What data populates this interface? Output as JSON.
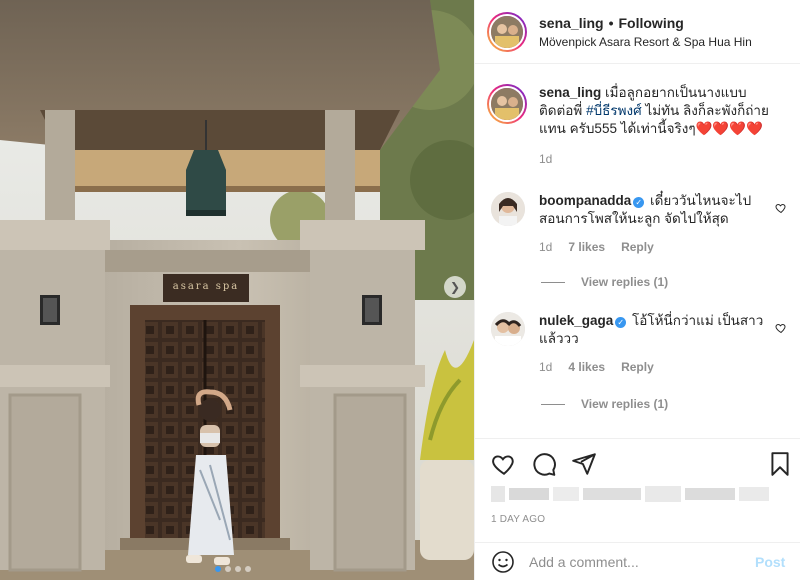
{
  "post": {
    "username": "sena_ling",
    "separator": "•",
    "follow_status": "Following",
    "location": "Mövenpick Asara Resort & Spa Hua Hin",
    "sign_text": "asara spa",
    "carousel_dots": 4,
    "carousel_active": 0
  },
  "caption": {
    "username": "sena_ling",
    "text_before": " เมื่อลูกอยากเป็นนางแบบ ติดต่อพี่ ",
    "hashtag": "#บี่ธีรพงศ์",
    "text_after": " ไม่ทัน ลิงก็ละพังก็ถ่ายแทน ครับ555 ได้เท่านี้จริงๆ",
    "hearts": "❤️❤️❤️❤️",
    "time": "1d"
  },
  "comments": [
    {
      "username": "boompanadda",
      "verified": true,
      "text": "เดี๋ยววันไหนจะไปสอนการโพสให้นะลูก จัดไปให้สุด",
      "time": "1d",
      "likes": "7 likes",
      "reply": "Reply",
      "view_replies": "View replies (1)"
    },
    {
      "username": "nulek_gaga",
      "verified": true,
      "text": "โอ้โห้นี่กว่าแม่ เป็นสาวแล้ววว",
      "time": "1d",
      "likes": "4 likes",
      "reply": "Reply",
      "view_replies": "View replies (1)"
    }
  ],
  "footer": {
    "time_ago": "1 DAY AGO",
    "add_comment_placeholder": "Add a comment...",
    "post_label": "Post"
  },
  "icons": {
    "like": "heart-icon",
    "comment": "comment-icon",
    "share": "share-icon",
    "save": "bookmark-icon",
    "emoji": "emoji-icon",
    "comment_like": "heart-icon"
  },
  "colors": {
    "link": "#00376b",
    "verified": "#3897f0",
    "muted": "#8e8e8e",
    "post_button": "#b2dffc",
    "heart": "#ed4956"
  }
}
